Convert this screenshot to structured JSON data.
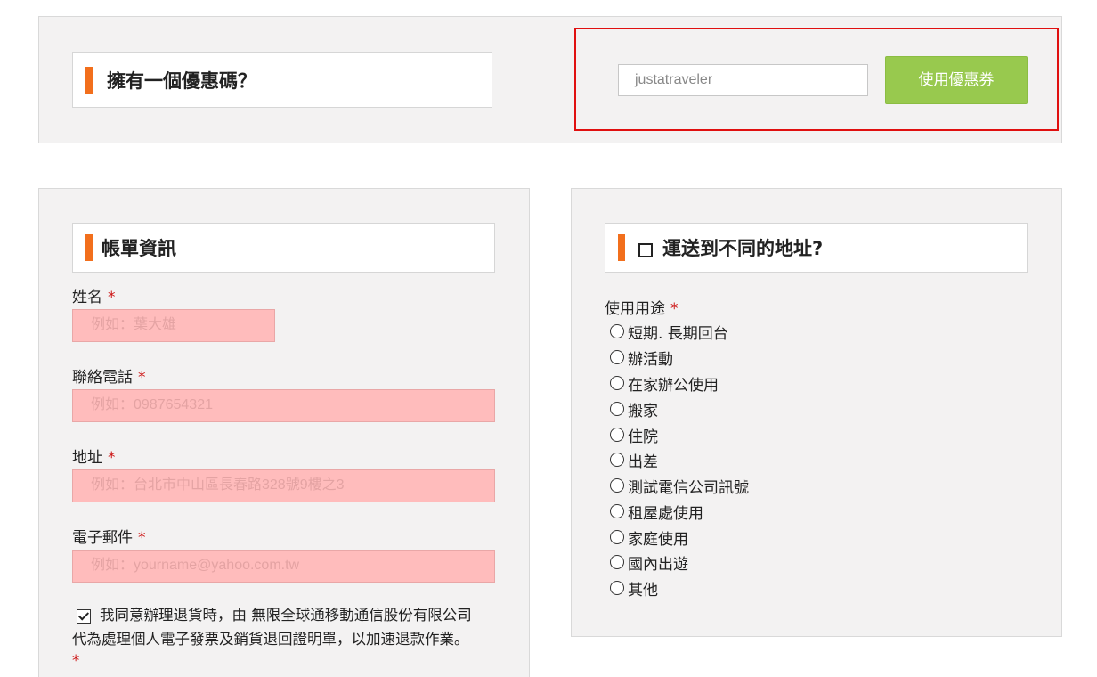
{
  "coupon": {
    "title": "擁有一個優惠碼？",
    "input_value": "justatraveler",
    "button_label": "使用優惠券"
  },
  "billing": {
    "title": "帳單資訊",
    "required_mark": "*",
    "fields": [
      {
        "label": "姓名",
        "placeholder": "例如：葉大雄"
      },
      {
        "label": "聯絡電話",
        "placeholder": "例如：0987654321"
      },
      {
        "label": "地址",
        "placeholder": "例如：台北市中山區長春路328號9樓之3"
      },
      {
        "label": "電子郵件",
        "placeholder": "例如：yourname@yahoo.com.tw"
      }
    ],
    "consent_line1": "我同意辦理退貨時，由 無限全球通移動通信股份有限公司",
    "consent_line2": "代為處理個人電子發票及銷貨退回證明單，以加速退款作業。",
    "consent_checked": true
  },
  "shipping": {
    "title": "運送到不同的地址?",
    "usage_label": "使用用途",
    "options": [
      "短期.  長期回台",
      "辦活動",
      "在家辦公使用",
      "搬家",
      "住院",
      "出差",
      "測試電信公司訊號",
      "租屋處使用",
      "家庭使用",
      "國內出遊",
      "其他"
    ]
  }
}
